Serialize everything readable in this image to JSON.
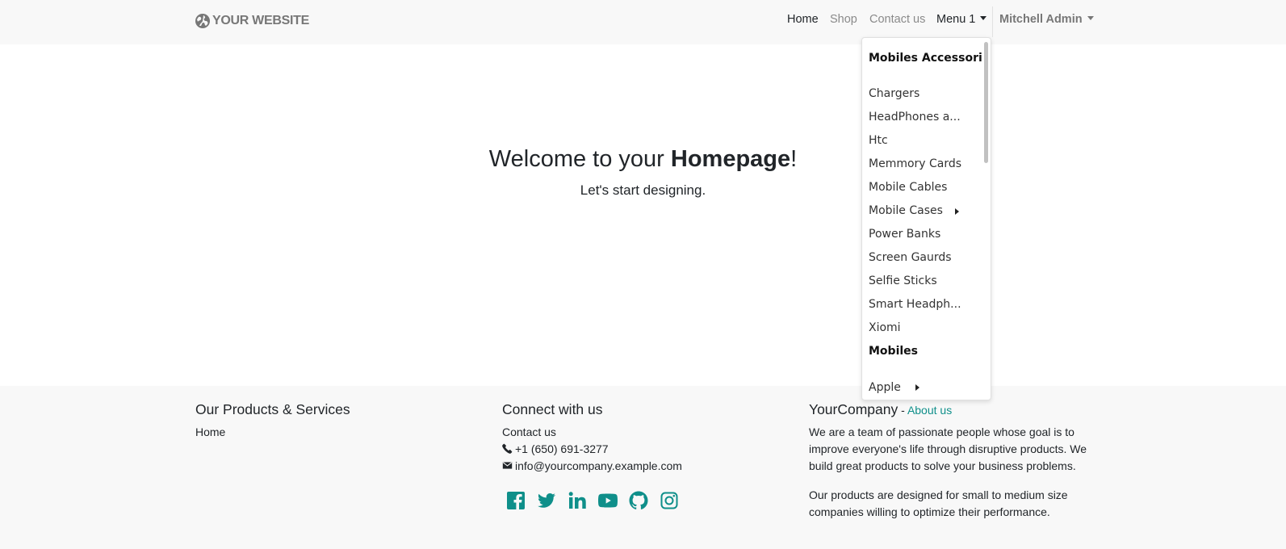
{
  "navbar": {
    "brand": "YOUR WEBSITE",
    "links": [
      "Home",
      "Shop",
      "Contact us"
    ],
    "menu1": "Menu 1",
    "user": "Mitchell Admin"
  },
  "hero": {
    "title_pre": "Welcome to your ",
    "title_bold": "Homepage",
    "title_post": "!",
    "subtitle": "Let's start designing."
  },
  "dropdown": {
    "sections": [
      {
        "header": "Mobiles Accessories",
        "items": [
          "Chargers",
          "HeadPhones a...",
          "Htc",
          "Memmory Cards",
          "Mobile Cables",
          "Mobile Cases",
          "Power Banks",
          "Screen Gaurds",
          "Selfie Sticks",
          "Smart Headph...",
          "Xiomi"
        ]
      },
      {
        "header": "Mobiles",
        "items": [
          "Apple"
        ]
      }
    ]
  },
  "footer": {
    "col1": {
      "title": "Our Products & Services",
      "link": "Home"
    },
    "col2": {
      "title": "Connect with us",
      "link": "Contact us",
      "phone": "+1 (650) 691-3277",
      "email": "info@yourcompany.example.com",
      "social": [
        "facebook-icon",
        "twitter-icon",
        "linkedin-icon",
        "youtube-icon",
        "github-icon",
        "instagram-icon"
      ]
    },
    "col3": {
      "title": "YourCompany",
      "title_sep": " - ",
      "about": "About us",
      "para1": "We are a team of passionate people whose goal is to improve everyone's life through disruptive products. We build great products to solve your business problems.",
      "para2": "Our products are designed for small to medium size companies willing to optimize their performance."
    }
  },
  "colors": {
    "accent": "#0f8f8a",
    "navbar_bg": "#f8f8f8",
    "footer_bg": "#f8f8f8"
  }
}
